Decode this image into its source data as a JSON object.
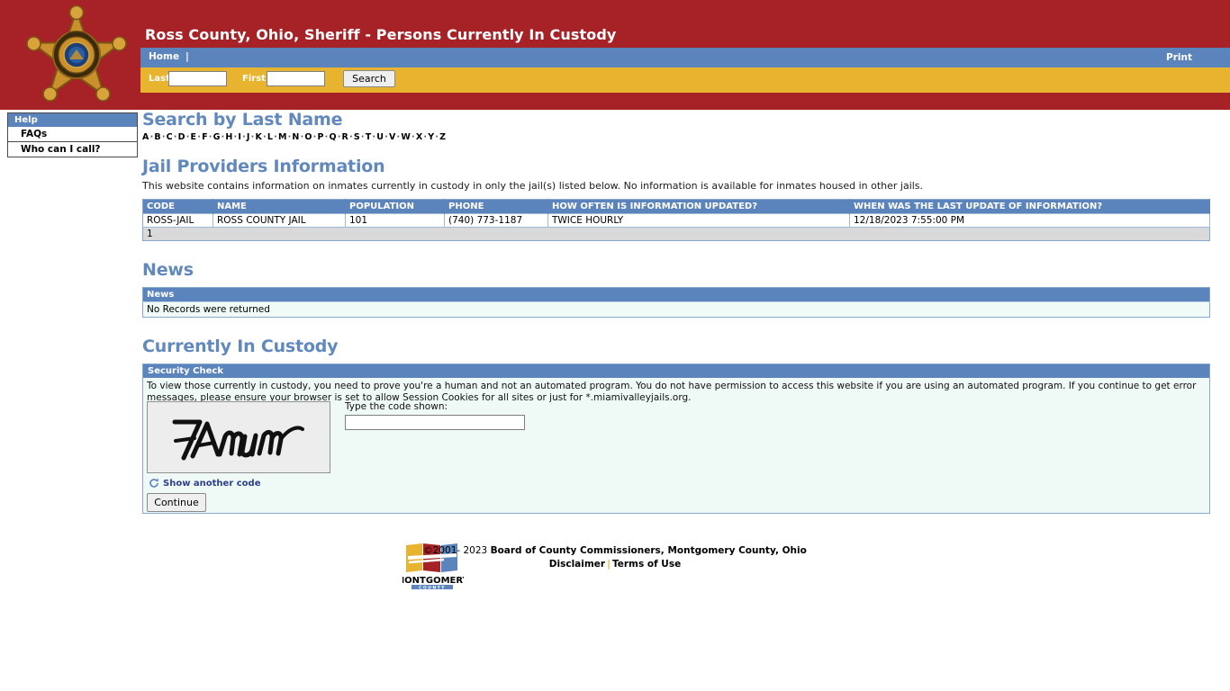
{
  "header": {
    "site_title": "Ross County, Ohio, Sheriff - Persons Currently In Custody",
    "badge_icon": "sheriff-star-badge-icon",
    "nav": {
      "home_label": "Home",
      "separator": "|",
      "print_label": "Print"
    },
    "search": {
      "last_label": "Last",
      "last_value": "",
      "first_label": "First",
      "first_value": "",
      "button_label": "Search"
    }
  },
  "sidebar": {
    "heading": "Help",
    "items": [
      {
        "label": "FAQs"
      },
      {
        "label": "Who can I call?"
      }
    ]
  },
  "main": {
    "search_by_last_name": {
      "heading": "Search by Last Name",
      "letters": [
        "A",
        "B",
        "C",
        "D",
        "E",
        "F",
        "G",
        "H",
        "I",
        "J",
        "K",
        "L",
        "M",
        "N",
        "O",
        "P",
        "Q",
        "R",
        "S",
        "T",
        "U",
        "V",
        "W",
        "X",
        "Y",
        "Z"
      ],
      "separator": "·"
    },
    "jail_providers": {
      "heading": "Jail Providers Information",
      "intro": "This website contains information on inmates currently in custody in only the jail(s) listed below. No information is available for inmates housed in other jails.",
      "columns": [
        "CODE",
        "NAME",
        "POPULATION",
        "PHONE",
        "HOW OFTEN IS INFORMATION UPDATED?",
        "WHEN WAS THE LAST UPDATE OF INFORMATION?"
      ],
      "rows": [
        {
          "code": "ROSS-JAIL",
          "name": "ROSS COUNTY JAIL",
          "population": "101",
          "phone": "(740) 773-1187",
          "update_frequency": "TWICE HOURLY",
          "last_update": "12/18/2023 7:55:00 PM"
        }
      ],
      "pager": "1"
    },
    "news": {
      "heading": "News",
      "column": "News",
      "empty_message": "No Records were returned"
    },
    "custody": {
      "heading": "Currently In Custody",
      "security_heading": "Security Check",
      "security_text": "To view those currently in custody, you need to prove you're a human and not an automated program. You do not have permission to access this website if you are using an automated program. If you continue to get error messages, please ensure your browser is set to allow Session Cookies for all sites or just for *.miamivalleyjails.org.",
      "captcha_text": "7Amum",
      "captcha_icon": "captcha-image",
      "refresh_icon": "refresh-icon",
      "refresh_label": "Show another code",
      "code_label": "Type the code shown:",
      "code_value": "",
      "continue_label": "Continue"
    }
  },
  "footer": {
    "logo_icon": "montgomery-county-logo",
    "logo_text": "MONTGOMERY",
    "logo_subtext": "COUNTY",
    "copyright_prefix": "©2001- 2023 ",
    "copyright_org": "Board of County Commissioners, Montgomery County, Ohio",
    "disclaimer_label": "Disclaimer",
    "separator": "|",
    "terms_label": "Terms of Use"
  },
  "colors": {
    "brand_red": "#a62226",
    "nav_blue": "#5b84bd",
    "search_gold": "#e8b430",
    "heading_blue": "#6189bd",
    "panel_mint": "#eff9f6",
    "pager_gray": "#d9d9d9"
  }
}
